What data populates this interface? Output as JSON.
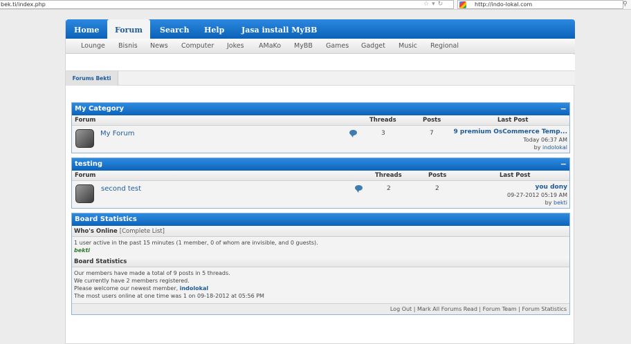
{
  "browser": {
    "url": "bek.ti/index.php",
    "search_text": "http://indo-lokal.com"
  },
  "menu": {
    "items": [
      "Home",
      "Forum",
      "Search",
      "Help",
      "Jasa install MyBB"
    ],
    "active": "Forum"
  },
  "submenu": [
    "Lounge",
    "Bisnis",
    "News",
    "Computer",
    "Jokes",
    "AMaKo",
    "MyBB",
    "Games",
    "Gadget",
    "Music",
    "Regional"
  ],
  "breadcrumb": "Forums Bekti",
  "categories": [
    {
      "title": "My Category",
      "collapse": "−",
      "columns": {
        "forum": "Forum",
        "threads": "Threads",
        "posts": "Posts",
        "last_post": "Last Post"
      },
      "forum": {
        "name": "My Forum",
        "threads": "3",
        "posts": "7",
        "last_title": "9 premium OsCommerce Temp...",
        "last_time": "Today 06:37 AM",
        "by": "by",
        "last_user": "indolokal"
      }
    },
    {
      "title": "testing",
      "collapse": "−",
      "columns": {
        "forum": "Forum",
        "threads": "Threads",
        "posts": "Posts",
        "last_post": "Last Post"
      },
      "forum": {
        "name": "second test",
        "threads": "2",
        "posts": "2",
        "last_title": "you dony",
        "last_time": "09-27-2012 05:19 AM",
        "by": "by",
        "last_user": "bekti"
      }
    }
  ],
  "board_stats": {
    "title": "Board Statistics",
    "whos_online": "Who's Online",
    "complete_list": "[Complete List]",
    "online_text": "1 user active in the past 15 minutes (1 member, 0 of whom are invisible, and 0 guests).",
    "online_user": "bekti",
    "stats_title": "Board Statistics",
    "line1": "Our members have made a total of 9 posts in 5 threads.",
    "line2": "We currently have 2 members registered.",
    "line3_prefix": "Please welcome our newest member,",
    "newest_member": "indolokal",
    "line4": "The most users online at one time was 1 on 09-18-2012 at 05:56 PM"
  },
  "footer_links": [
    "Log Out",
    "Mark All Forums Read",
    "Forum Team",
    "Forum Statistics"
  ]
}
